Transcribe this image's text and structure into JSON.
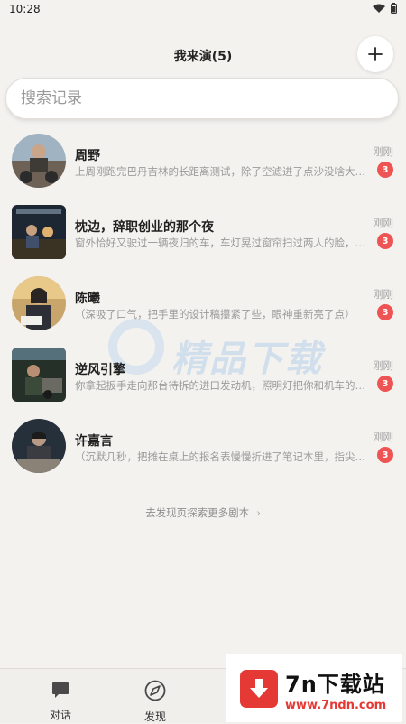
{
  "status": {
    "time": "10:28"
  },
  "header": {
    "title": "我来演(5)"
  },
  "search": {
    "placeholder": "搜索记录"
  },
  "conversations": [
    {
      "name": "周野",
      "preview": "上周刚跑完巴丹吉林的长距离测试，除了空滤进了点沙没啥大问题",
      "time": "刚刚",
      "unread": "3"
    },
    {
      "name": "枕边，辞职创业的那个夜",
      "preview": "窗外恰好又驶过一辆夜归的车，车灯晃过窗帘扫过两人的脸，…",
      "time": "刚刚",
      "unread": "3"
    },
    {
      "name": "陈曦",
      "preview": "（深吸了口气，把手里的设计稿攥紧了些，眼神重新亮了点）",
      "time": "刚刚",
      "unread": "3"
    },
    {
      "name": "逆风引擎",
      "preview": "你拿起扳手走向那台待拆的进口发动机，照明灯把你和机车的影子",
      "time": "刚刚",
      "unread": "3"
    },
    {
      "name": "许嘉言",
      "preview": "（沉默几秒，把摊在桌上的报名表慢慢折进了笔记本里，指尖…",
      "time": "刚刚",
      "unread": "3"
    }
  ],
  "discover": {
    "label": "去发现页探索更多剧本",
    "chevron": "›"
  },
  "watermark": {
    "text": "精品下载"
  },
  "tabs": [
    {
      "label": "对话",
      "icon": "chat-bubble-icon"
    },
    {
      "label": "发现",
      "icon": "compass-icon"
    }
  ],
  "ad": {
    "title": "7n下载站",
    "url": "www.7ndn.com"
  },
  "colors": {
    "badge": "#ee5454",
    "background": "#f4f2ef",
    "ad_red": "#e53935"
  }
}
